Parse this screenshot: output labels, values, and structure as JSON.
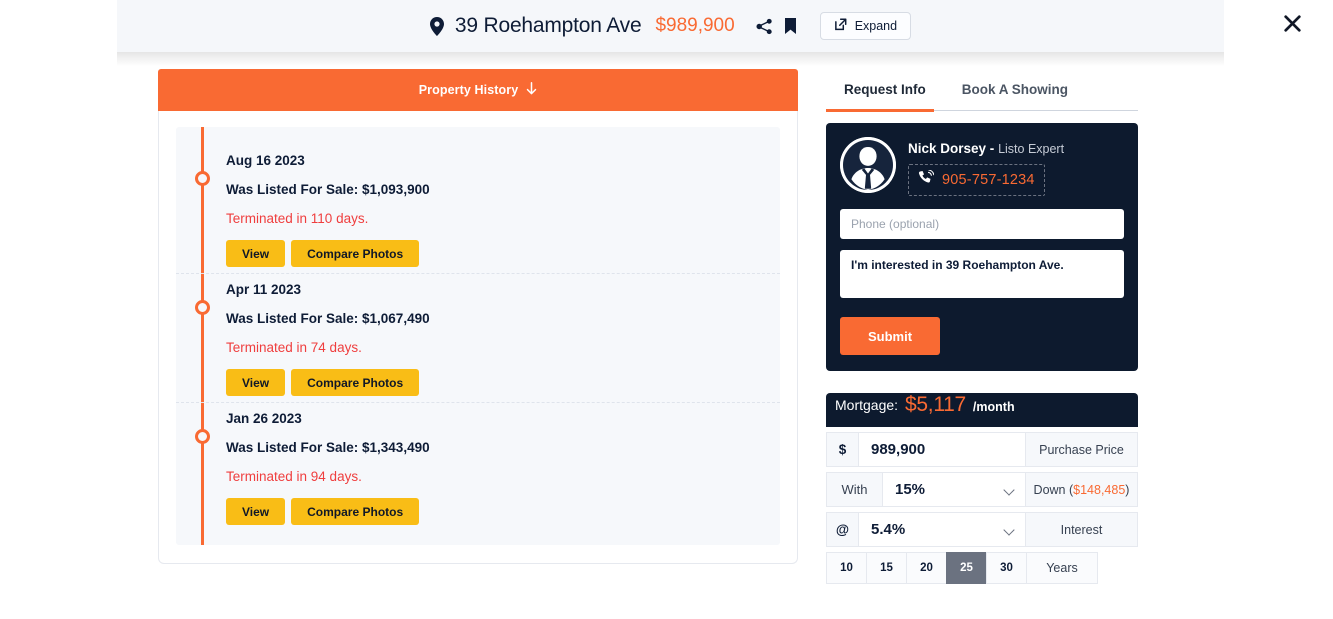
{
  "topbar": {
    "pin_icon": "map-pin-icon",
    "address": "39 Roehampton Ave",
    "price": "$989,900",
    "share_icon": "share-icon",
    "bookmark_icon": "bookmark-icon",
    "expand_label": "Expand",
    "expand_icon": "external-link-icon",
    "close_icon": "close-icon"
  },
  "history": {
    "header_label": "Property History",
    "header_arrow": "arrow-down-icon",
    "entries": [
      {
        "date": "Aug 16 2023",
        "listed": "Was Listed For Sale: $1,093,900",
        "terminated": "Terminated in 110 days.",
        "view_label": "View",
        "compare_label": "Compare Photos"
      },
      {
        "date": "Apr 11 2023",
        "listed": "Was Listed For Sale: $1,067,490",
        "terminated": "Terminated in 74 days.",
        "view_label": "View",
        "compare_label": "Compare Photos"
      },
      {
        "date": "Jan 26 2023",
        "listed": "Was Listed For Sale: $1,343,490",
        "terminated": "Terminated in 94 days.",
        "view_label": "View",
        "compare_label": "Compare Photos"
      }
    ]
  },
  "rail": {
    "tabs": [
      {
        "label": "Request Info",
        "active": true
      },
      {
        "label": "Book A Showing",
        "active": false
      }
    ],
    "agent": {
      "avatar_icon": "avatar-person-icon",
      "name": "Nick Dorsey -",
      "role": "Listo Expert",
      "phone_icon": "phone-ring-icon",
      "phone": "905-757-1234",
      "phone_placeholder": "Phone (optional)",
      "phone_value": "",
      "message_value": "I'm interested in 39 Roehampton Ave.",
      "submit_label": "Submit"
    },
    "mortgage": {
      "label": "Mortgage:",
      "amount": "$5,117",
      "per": "/month",
      "price_prefix": "$",
      "price_value": "989,900",
      "price_suffix": "Purchase Price",
      "down_prefix": "With",
      "down_value": "15%",
      "down_suffix_text": "Down (",
      "down_suffix_amount": "$148,485",
      "down_suffix_close": ")",
      "interest_prefix": "@",
      "interest_value": "5.4%",
      "interest_suffix": "Interest",
      "years_options": [
        "10",
        "15",
        "20",
        "25",
        "30"
      ],
      "years_selected": "25",
      "years_label": "Years"
    }
  },
  "colors": {
    "accent_orange": "#f96a33",
    "amber": "#f9bd16",
    "navy": "#0d1a2e",
    "red": "#ef3e3e",
    "active_gray": "#6b7280"
  }
}
